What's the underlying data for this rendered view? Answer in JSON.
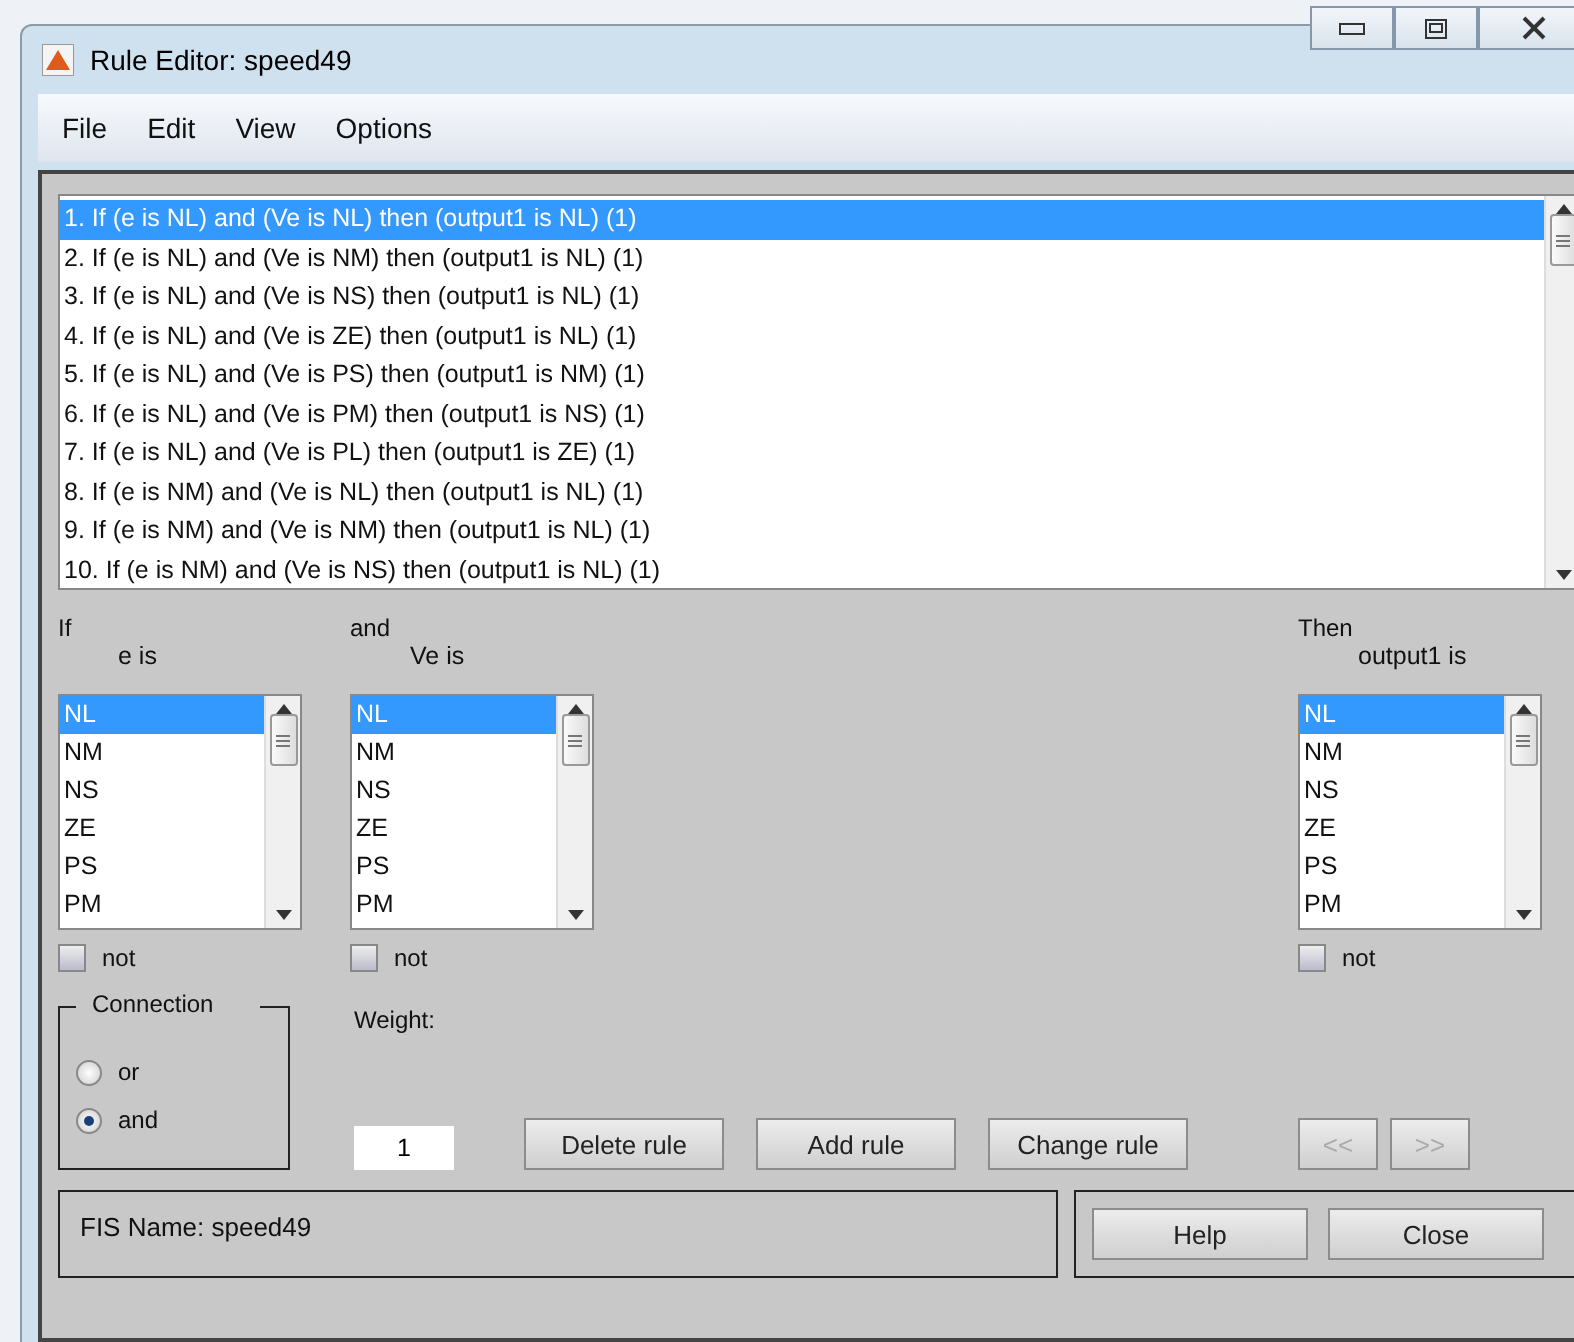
{
  "window": {
    "title": "Rule Editor: speed49"
  },
  "menu": [
    "File",
    "Edit",
    "View",
    "Options"
  ],
  "rules": [
    {
      "text": "1. If (e is NL) and (Ve is NL) then (output1 is NL) (1)",
      "selected": true
    },
    {
      "text": "2. If (e is NL) and (Ve is NM) then (output1 is NL) (1)",
      "selected": false
    },
    {
      "text": "3. If (e is NL) and (Ve is NS) then (output1 is NL) (1)",
      "selected": false
    },
    {
      "text": "4. If (e is NL) and (Ve is ZE) then (output1 is NL) (1)",
      "selected": false
    },
    {
      "text": "5. If (e is NL) and (Ve is PS) then (output1 is NM) (1)",
      "selected": false
    },
    {
      "text": "6. If (e is NL) and (Ve is PM) then (output1 is NS) (1)",
      "selected": false
    },
    {
      "text": "7. If (e is NL) and (Ve is PL) then (output1 is ZE) (1)",
      "selected": false
    },
    {
      "text": "8. If (e is NM) and (Ve is NL) then (output1 is NL) (1)",
      "selected": false
    },
    {
      "text": "9. If (e is NM) and (Ve is NM) then (output1 is NL) (1)",
      "selected": false
    },
    {
      "text": "10. If (e is NM) and (Ve is NS) then (output1 is NL) (1)",
      "selected": false
    }
  ],
  "variables": [
    {
      "heading": "If",
      "name": "e is",
      "not": {
        "label": "not",
        "checked": false
      },
      "items": [
        {
          "label": "NL",
          "selected": true
        },
        {
          "label": "NM",
          "selected": false
        },
        {
          "label": "NS",
          "selected": false
        },
        {
          "label": "ZE",
          "selected": false
        },
        {
          "label": "PS",
          "selected": false
        },
        {
          "label": "PM",
          "selected": false
        }
      ]
    },
    {
      "heading": "and",
      "name": "Ve is",
      "not": {
        "label": "not",
        "checked": false
      },
      "items": [
        {
          "label": "NL",
          "selected": true
        },
        {
          "label": "NM",
          "selected": false
        },
        {
          "label": "NS",
          "selected": false
        },
        {
          "label": "ZE",
          "selected": false
        },
        {
          "label": "PS",
          "selected": false
        },
        {
          "label": "PM",
          "selected": false
        }
      ]
    },
    {
      "heading": "Then",
      "name": "output1 is",
      "not": {
        "label": "not",
        "checked": false
      },
      "items": [
        {
          "label": "NL",
          "selected": true
        },
        {
          "label": "NM",
          "selected": false
        },
        {
          "label": "NS",
          "selected": false
        },
        {
          "label": "ZE",
          "selected": false
        },
        {
          "label": "PS",
          "selected": false
        },
        {
          "label": "PM",
          "selected": false
        }
      ]
    }
  ],
  "connection": {
    "title": "Connection",
    "options": [
      {
        "label": "or",
        "selected": false
      },
      {
        "label": "and",
        "selected": true
      }
    ]
  },
  "weight": {
    "label": "Weight:",
    "value": "1"
  },
  "actions": [
    {
      "label": "Delete rule",
      "disabled": false
    },
    {
      "label": "Add rule",
      "disabled": false
    },
    {
      "label": "Change rule",
      "disabled": false
    }
  ],
  "nav": [
    {
      "label": "<<",
      "disabled": true
    },
    {
      "label": ">>",
      "disabled": true
    }
  ],
  "status": {
    "text": "FIS Name: speed49"
  },
  "footer_buttons": [
    {
      "label": "Help"
    },
    {
      "label": "Close"
    }
  ]
}
